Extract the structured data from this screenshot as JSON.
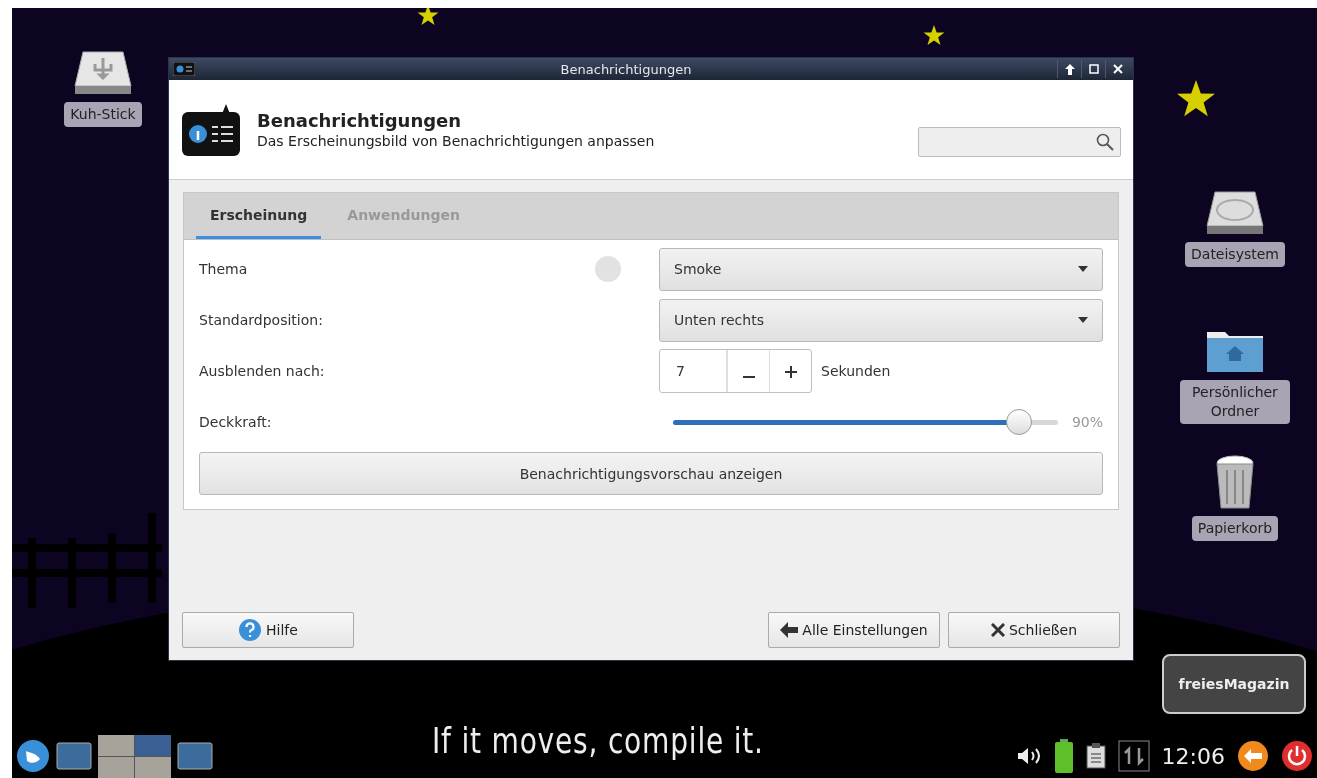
{
  "desktop": {
    "left_icons": [
      {
        "label": "Kuh-Stick",
        "kind": "usb"
      }
    ],
    "right_icons": [
      {
        "label": "Dateisystem",
        "kind": "drive"
      },
      {
        "label": "Persönlicher Ordner",
        "kind": "home"
      },
      {
        "label": "Papierkorb",
        "kind": "trash"
      }
    ],
    "wallpaper_text": "If it moves, compile it.",
    "badge": "freiesMagazin"
  },
  "window": {
    "title": "Benachrichtigungen",
    "heading": "Benachrichtigungen",
    "subtitle": "Das Erscheinungsbild von Benachrichtigungen anpassen",
    "tabs": [
      {
        "label": "Erscheinung",
        "selected": true
      },
      {
        "label": "Anwendungen",
        "selected": false
      }
    ],
    "settings": [
      {
        "kind": "dropdown",
        "label": "Thema",
        "value": "Smoke",
        "busy": true
      },
      {
        "kind": "dropdown",
        "label": "Standardposition:",
        "value": "Unten rechts",
        "busy": false
      },
      {
        "kind": "spin",
        "label": "Ausblenden nach:",
        "value": "7",
        "unit": "Sekunden",
        "busy": false
      },
      {
        "kind": "slider",
        "label": "Deckkraft:",
        "level": 0.9,
        "reading": "90%",
        "busy": false
      }
    ],
    "preview_button": "Benachrichtigungsvorschau anzeigen",
    "buttons": [
      {
        "label": "Hilfe",
        "kind": "help"
      },
      {
        "label": "Alle Einstellungen",
        "kind": "back"
      },
      {
        "label": "Schließen",
        "kind": "close"
      }
    ]
  },
  "taskbar": {
    "workspaces": [
      {
        "selected": false
      },
      {
        "selected": true
      },
      {
        "selected": false
      },
      {
        "selected": false
      }
    ],
    "clock": "12:06"
  }
}
